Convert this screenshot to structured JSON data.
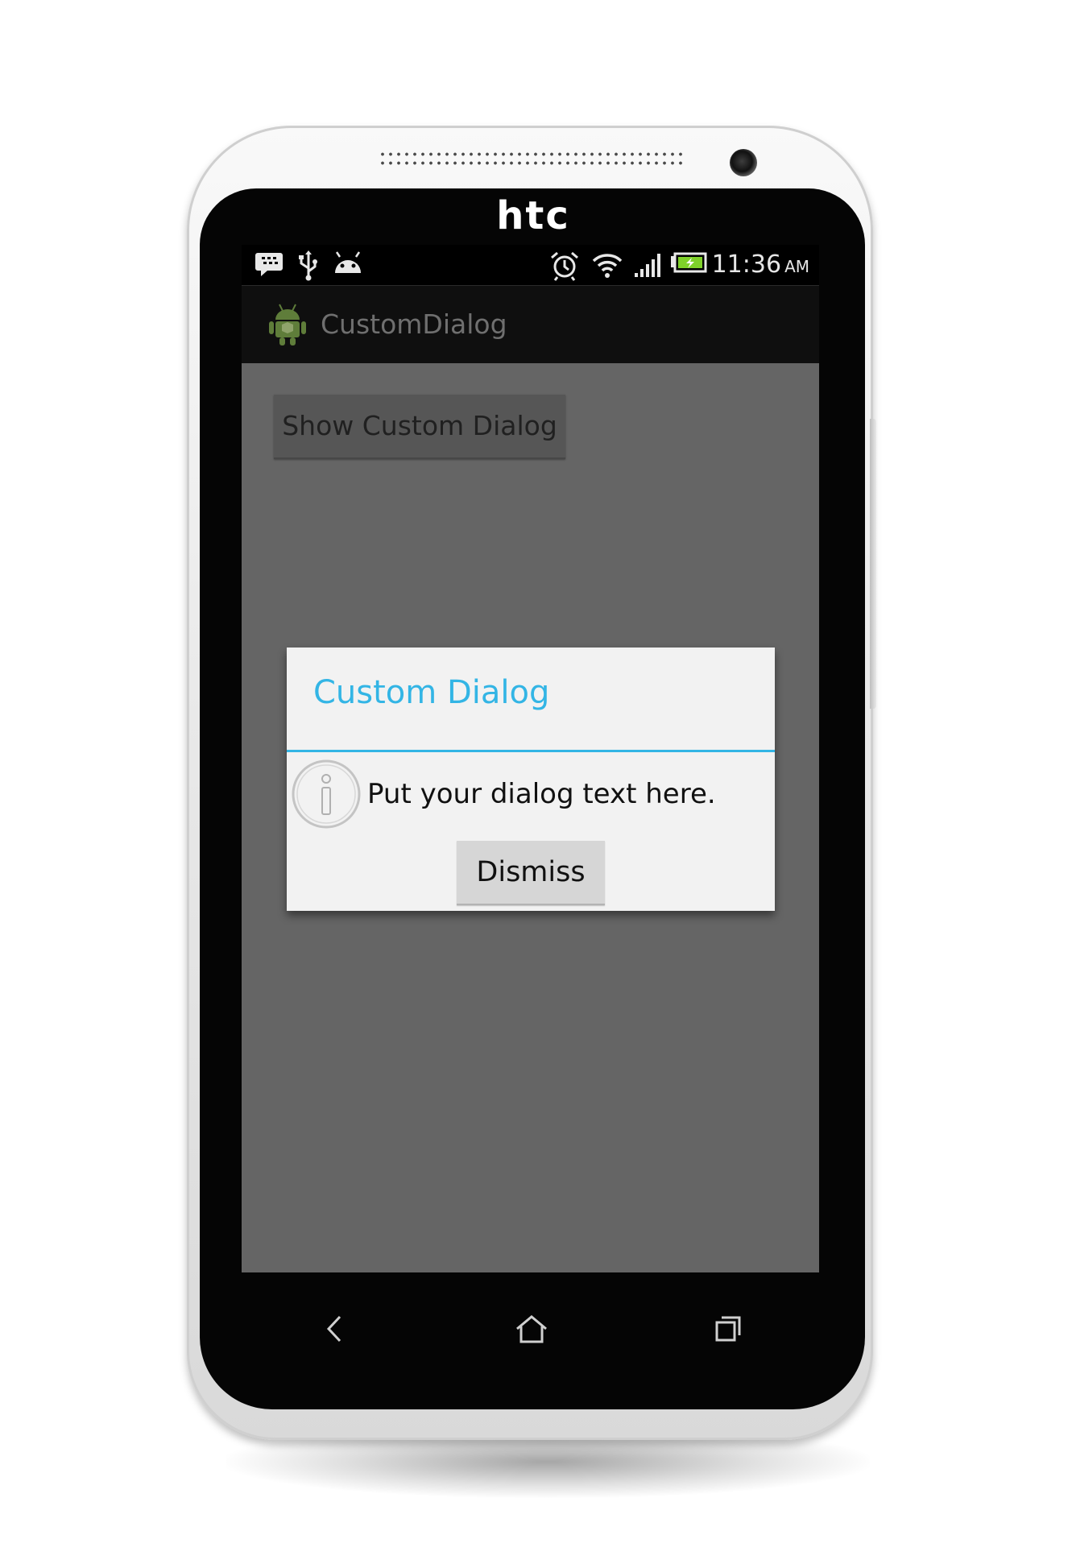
{
  "device": {
    "brand": "htc"
  },
  "status_bar": {
    "left_icons": [
      "blackberry-messenger-icon",
      "usb-icon",
      "android-debug-icon"
    ],
    "right_icons": [
      "alarm-clock-icon",
      "wifi-icon",
      "signal-bars-icon",
      "battery-charging-icon"
    ],
    "time": "11:36",
    "ampm": "AM"
  },
  "action_bar": {
    "app_icon": "android-robot-icon",
    "title": "CustomDialog"
  },
  "main": {
    "show_button_label": "Show Custom Dialog"
  },
  "dialog": {
    "title": "Custom Dialog",
    "icon": "info-icon",
    "message": "Put your dialog text here.",
    "dismiss_label": "Dismiss"
  },
  "nav_bar": {
    "buttons": [
      "back-icon",
      "home-icon",
      "recent-apps-icon"
    ]
  },
  "colors": {
    "accent": "#33b5e5",
    "screen_background": "#656565",
    "dialog_background": "#f2f2f2",
    "action_bar": "#0f0f0f",
    "status_bar": "#000000"
  }
}
